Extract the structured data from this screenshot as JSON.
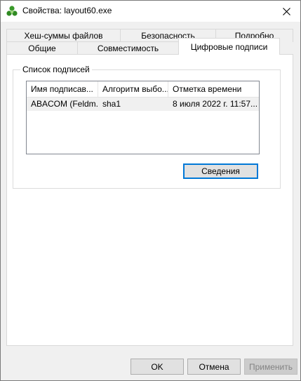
{
  "window": {
    "title": "Свойства: layout60.exe",
    "close_glyph": "✕"
  },
  "tabs": {
    "row_top": [
      {
        "label": "Хеш-суммы файлов"
      },
      {
        "label": "Безопасность"
      },
      {
        "label": "Подробно"
      }
    ],
    "row_bottom": [
      {
        "label": "Общие"
      },
      {
        "label": "Совместимость"
      },
      {
        "label": "Цифровые подписи"
      }
    ],
    "active": "Цифровые подписи"
  },
  "signatures": {
    "group_label": "Список подписей",
    "columns": [
      "Имя подписав...",
      "Алгоритм выбо...",
      "Отметка времени"
    ],
    "rows": [
      [
        "ABACOM (Feldm...",
        "sha1",
        "8 июля 2022 г. 11:57..."
      ]
    ],
    "details_button": "Сведения"
  },
  "footer": {
    "ok": "OK",
    "cancel": "Отмена",
    "apply": "Применить"
  },
  "colors": {
    "accent": "#0078d7",
    "client_bg": "#f0f0f0",
    "icon_green": "#3a9a2a"
  }
}
